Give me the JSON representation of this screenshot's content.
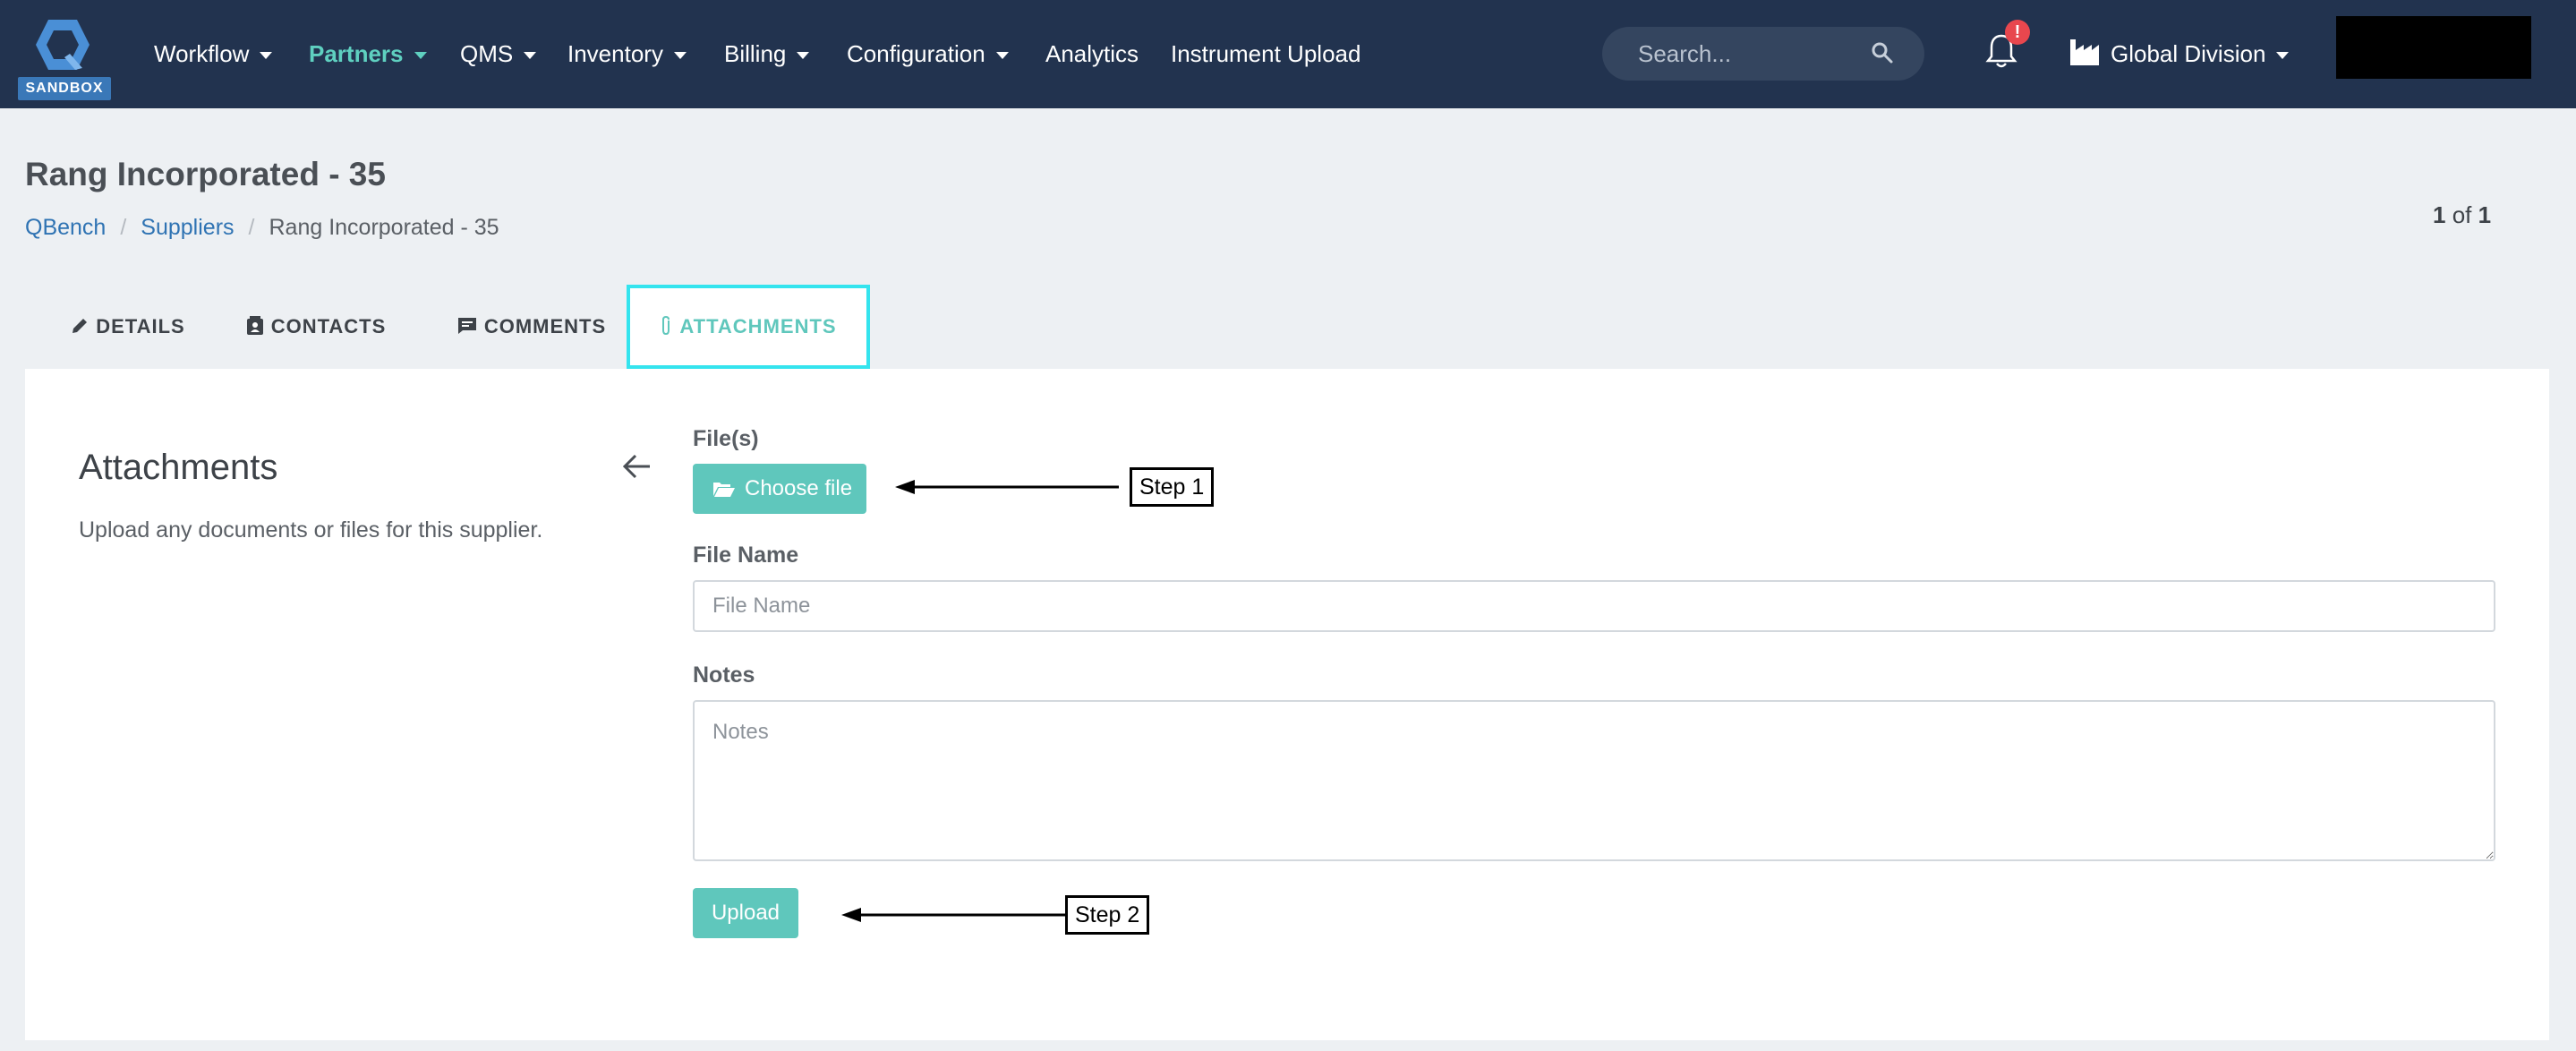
{
  "navbar": {
    "sandbox_label": "SANDBOX",
    "items": [
      {
        "label": "Workflow",
        "dropdown": true,
        "active": false
      },
      {
        "label": "Partners",
        "dropdown": true,
        "active": true
      },
      {
        "label": "QMS",
        "dropdown": true,
        "active": false
      },
      {
        "label": "Inventory",
        "dropdown": true,
        "active": false
      },
      {
        "label": "Billing",
        "dropdown": true,
        "active": false
      },
      {
        "label": "Configuration",
        "dropdown": true,
        "active": false
      },
      {
        "label": "Analytics",
        "dropdown": false,
        "active": false
      },
      {
        "label": "Instrument Upload",
        "dropdown": false,
        "active": false
      }
    ],
    "search_placeholder": "Search...",
    "notification_badge": "!",
    "division_label": "Global Division",
    "active_color": "#5fd0c0",
    "background_color": "#22334f"
  },
  "page": {
    "title": "Rang Incorporated - 35",
    "breadcrumb": [
      "QBench",
      "Suppliers",
      "Rang Incorporated - 35"
    ],
    "pager_current": "1",
    "pager_of": "of",
    "pager_total": "1"
  },
  "tabs": [
    {
      "label": "DETAILS",
      "icon": "pencil-icon",
      "active": false
    },
    {
      "label": "CONTACTS",
      "icon": "contact-card-icon",
      "active": false
    },
    {
      "label": "COMMENTS",
      "icon": "comment-icon",
      "active": false
    },
    {
      "label": "ATTACHMENTS",
      "icon": "paperclip-icon",
      "active": true
    }
  ],
  "attachments": {
    "title": "Attachments",
    "description": "Upload any documents or files for this supplier.",
    "files_label": "File(s)",
    "choose_file_label": "Choose file",
    "file_name_label": "File Name",
    "file_name_placeholder": "File Name",
    "notes_label": "Notes",
    "notes_placeholder": "Notes",
    "upload_label": "Upload",
    "accent_color": "#5fc7bc"
  },
  "annotations": {
    "step1": "Step 1",
    "step2": "Step 2"
  }
}
